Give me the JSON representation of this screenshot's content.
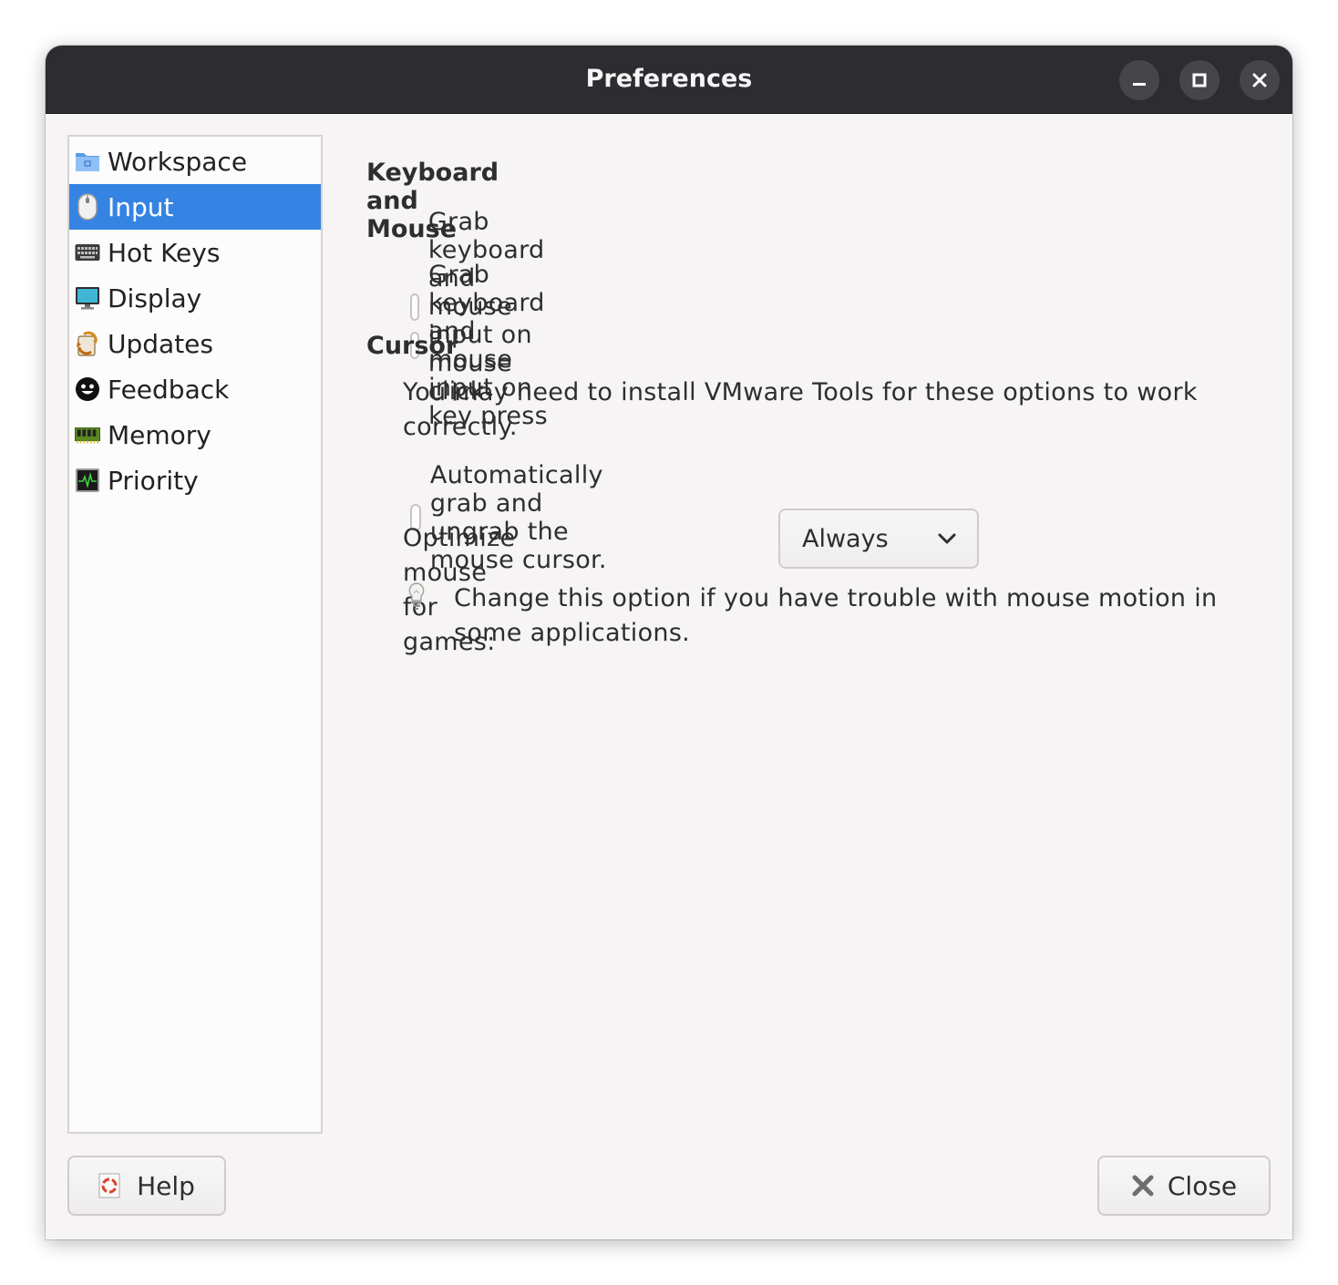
{
  "window": {
    "title": "Preferences",
    "controls": [
      "minimize-icon",
      "maximize-icon",
      "close-icon"
    ]
  },
  "sidebar": {
    "items": [
      {
        "label": "Workspace",
        "icon": "folder-icon",
        "selected": false
      },
      {
        "label": "Input",
        "icon": "mouse-icon",
        "selected": true
      },
      {
        "label": "Hot Keys",
        "icon": "keyboard-icon",
        "selected": false
      },
      {
        "label": "Display",
        "icon": "monitor-icon",
        "selected": false
      },
      {
        "label": "Updates",
        "icon": "updates-icon",
        "selected": false
      },
      {
        "label": "Feedback",
        "icon": "smiley-icon",
        "selected": false
      },
      {
        "label": "Memory",
        "icon": "memory-chip-icon",
        "selected": false
      },
      {
        "label": "Priority",
        "icon": "activity-monitor-icon",
        "selected": false
      }
    ]
  },
  "main": {
    "keyboard_mouse": {
      "heading": "Keyboard and Mouse",
      "options": [
        {
          "label": "Grab keyboard and mouse input on mouse click",
          "checked": false
        },
        {
          "label": "Grab keyboard and mouse input on key press",
          "checked": false
        }
      ]
    },
    "cursor": {
      "heading": "Cursor",
      "note": "You may need to install VMware Tools for these options to work correctly.",
      "auto_grab": {
        "label": "Automatically grab and ungrab the mouse cursor.",
        "checked": false
      },
      "optimize_label": "Optimize mouse for games:",
      "optimize_value": "Always",
      "hint": "Change this option if you have trouble with mouse motion in some applications."
    }
  },
  "footer": {
    "help_label": "Help",
    "close_label": "Close"
  },
  "colors": {
    "titlebar": "#2d2c31",
    "accent": "#3584e4",
    "background": "#f6f4f4"
  }
}
